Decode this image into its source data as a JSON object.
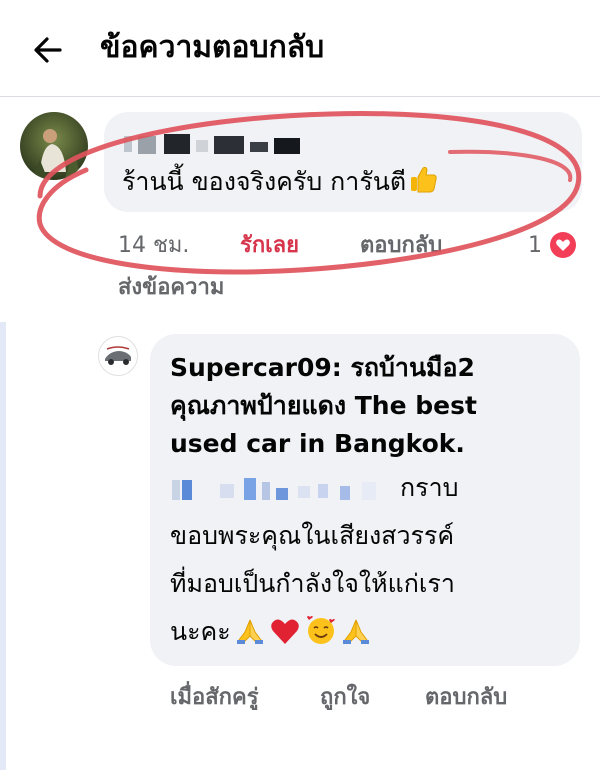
{
  "header": {
    "title": "ข้อความตอบกลับ",
    "back_icon": "arrow-left-icon"
  },
  "comment": {
    "author_redacted": true,
    "text": "ร้านนี้ ของจริงครับ การันตี",
    "emoji": "thumbs-up-icon",
    "time": "14 ชม.",
    "reaction_selected": "รักเลย",
    "reply_label": "ตอบกลับ",
    "reaction_count": "1",
    "reaction_icon": "heart-icon",
    "send_message": "ส่งข้อความ",
    "highlight_color": "#e0545c"
  },
  "reply": {
    "line1": "Supercar09: รถบ้านมือ2",
    "line2": "คุณภาพป้ายแดง The best",
    "line3": "used car in Bangkok.",
    "line4_suffix": "กราบ",
    "line5": "ขอบพระคุณในเสียงสวรรค์",
    "line6": "ที่มอบเป็นกำลังใจให้แก่เรา",
    "line7": "นะคะ",
    "emojis": [
      "folded-hands-icon",
      "red-heart-icon",
      "smiling-face-with-hearts-icon",
      "folded-hands-icon"
    ],
    "time": "เมื่อสักครู่",
    "like_label": "ถูกใจ",
    "reply_label": "ตอบกลับ"
  },
  "colors": {
    "accent_love": "#d6354c",
    "meta_gray": "#65676b",
    "bubble_bg": "#f0f2f5",
    "thread_line": "#e4e9f7"
  }
}
